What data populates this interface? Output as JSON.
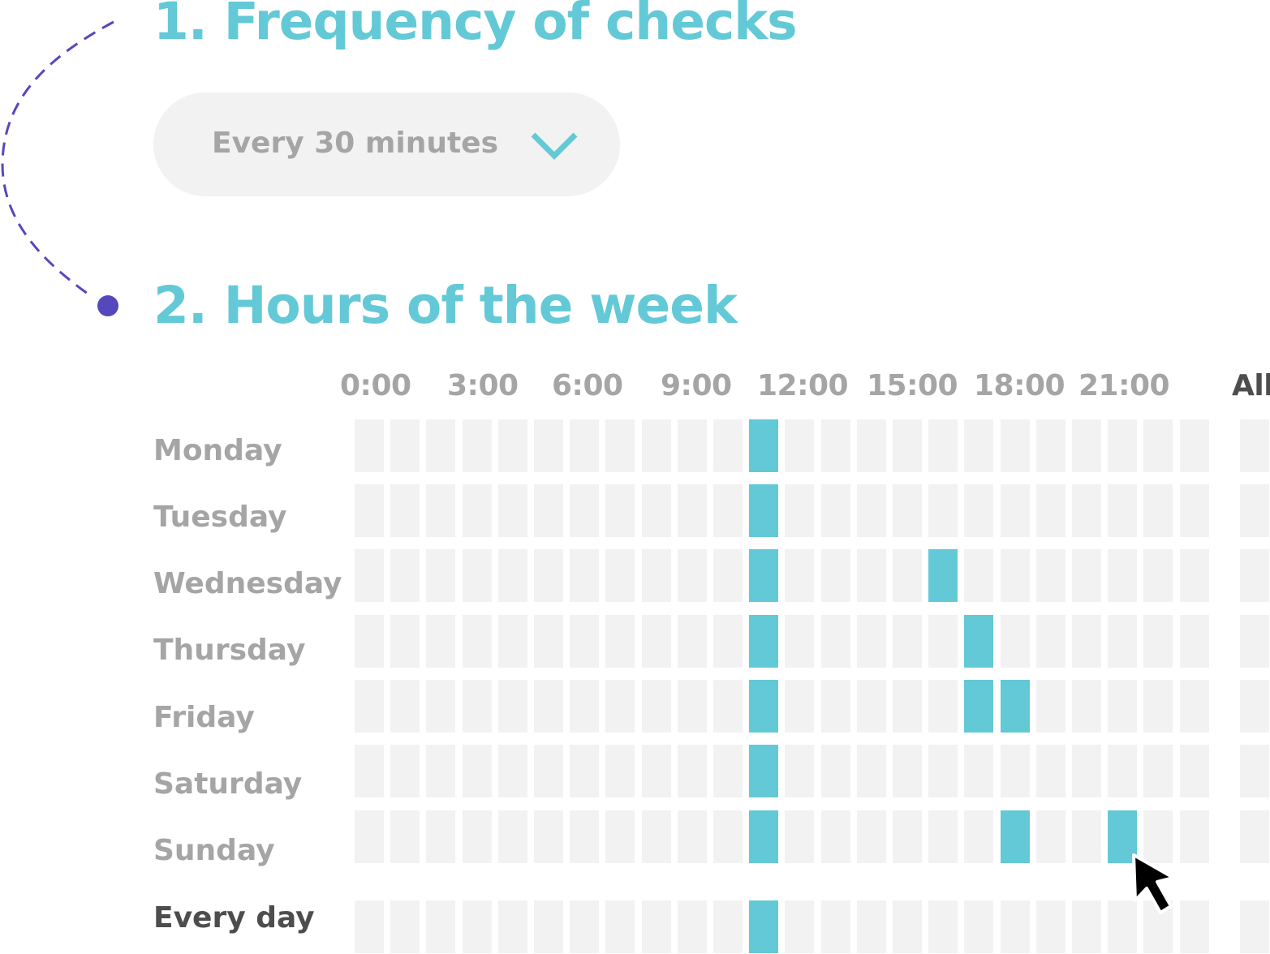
{
  "section1": {
    "title": "1. Frequency of checks",
    "frequency_select": {
      "value": "Every 30 minutes",
      "icon": "chevron-down-icon"
    }
  },
  "section2": {
    "title": "2. Hours of the week",
    "hour_labels": [
      "0:00",
      "3:00",
      "6:00",
      "9:00",
      "12:00",
      "15:00",
      "18:00",
      "21:00"
    ],
    "all_label": "All",
    "rows": [
      {
        "label": "Monday",
        "active": [
          11
        ]
      },
      {
        "label": "Tuesday",
        "active": [
          11
        ]
      },
      {
        "label": "Wednesday",
        "active": [
          11,
          16
        ]
      },
      {
        "label": "Thursday",
        "active": [
          11,
          17
        ]
      },
      {
        "label": "Friday",
        "active": [
          11,
          17,
          18
        ]
      },
      {
        "label": "Saturday",
        "active": [
          11
        ]
      },
      {
        "label": "Sunday",
        "active": [
          11,
          18,
          21
        ]
      }
    ],
    "every_day": {
      "label": "Every day",
      "active": [
        11
      ]
    },
    "hours_per_row": 24
  },
  "colors": {
    "accent": "#63c9d6",
    "cell_off": "#f2f2f2",
    "label_muted": "#a5a5a5",
    "label_strong": "#4d4d4d",
    "connector": "#5548bd"
  }
}
